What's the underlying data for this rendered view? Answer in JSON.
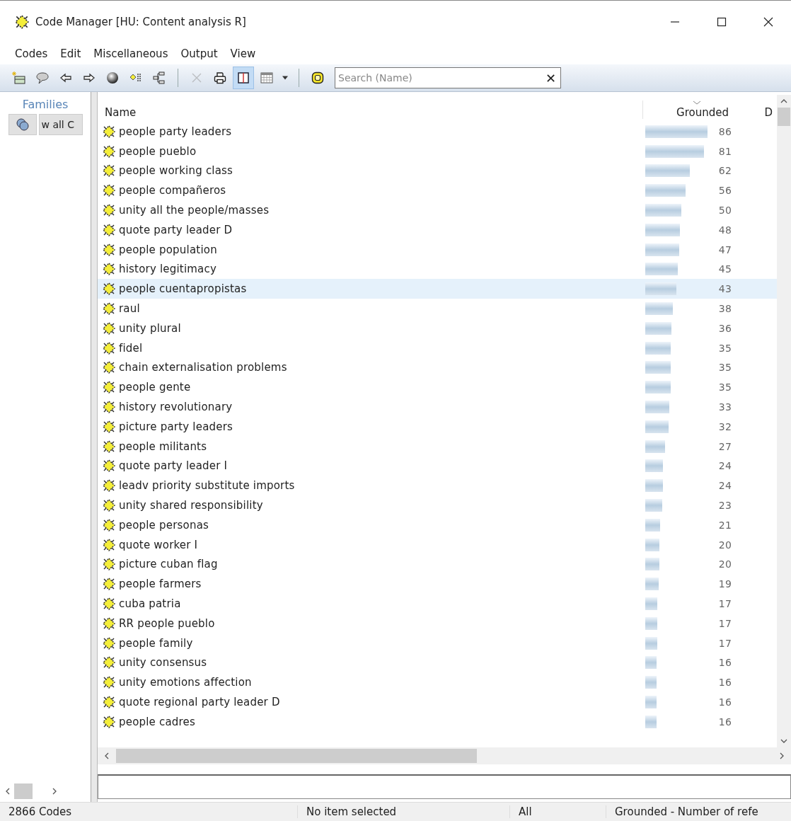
{
  "window": {
    "title": "Code Manager [HU: Content analysis R]"
  },
  "menu": [
    "Codes",
    "Edit",
    "Miscellaneous",
    "Output",
    "View"
  ],
  "toolbar": [
    {
      "kind": "new-code",
      "pressed": false,
      "disabled": false
    },
    {
      "kind": "comment",
      "pressed": false,
      "disabled": false
    },
    {
      "kind": "back",
      "pressed": false,
      "disabled": false
    },
    {
      "kind": "forward",
      "pressed": false,
      "disabled": false
    },
    {
      "kind": "sphere",
      "pressed": false,
      "disabled": false
    },
    {
      "kind": "code-list",
      "pressed": false,
      "disabled": false
    },
    {
      "kind": "tree",
      "pressed": false,
      "disabled": false
    },
    {
      "kind": "sep"
    },
    {
      "kind": "delete",
      "pressed": false,
      "disabled": true
    },
    {
      "kind": "print",
      "pressed": false,
      "disabled": false
    },
    {
      "kind": "split",
      "pressed": true,
      "disabled": false
    },
    {
      "kind": "grid",
      "pressed": false,
      "disabled": false
    },
    {
      "kind": "dropdown",
      "pressed": false,
      "disabled": false
    },
    {
      "kind": "sep"
    },
    {
      "kind": "code-filter",
      "pressed": false,
      "disabled": false
    }
  ],
  "search": {
    "placeholder": "Search (Name)",
    "clear": "✕"
  },
  "sidebar": {
    "title": "Families",
    "button": "w all C"
  },
  "table": {
    "columns": [
      "Name",
      "Grounded",
      "D"
    ],
    "rows": [
      {
        "name": "people party leaders",
        "grounded": "86",
        "hovered": false
      },
      {
        "name": "people pueblo",
        "grounded": "81",
        "hovered": false
      },
      {
        "name": "people working class",
        "grounded": "62",
        "hovered": false
      },
      {
        "name": "people compañeros",
        "grounded": "56",
        "hovered": false
      },
      {
        "name": "unity all the people/masses",
        "grounded": "50",
        "hovered": false
      },
      {
        "name": "quote party leader D",
        "grounded": "48",
        "hovered": false
      },
      {
        "name": "people population",
        "grounded": "47",
        "hovered": false
      },
      {
        "name": "history legitimacy",
        "grounded": "45",
        "hovered": false
      },
      {
        "name": "people cuentapropistas",
        "grounded": "43",
        "hovered": true
      },
      {
        "name": "raul",
        "grounded": "38",
        "hovered": false
      },
      {
        "name": "unity plural",
        "grounded": "36",
        "hovered": false
      },
      {
        "name": "fidel",
        "grounded": "35",
        "hovered": false
      },
      {
        "name": "chain externalisation problems",
        "grounded": "35",
        "hovered": false
      },
      {
        "name": "people gente",
        "grounded": "35",
        "hovered": false
      },
      {
        "name": "history revolutionary",
        "grounded": "33",
        "hovered": false
      },
      {
        "name": "picture party leaders",
        "grounded": "32",
        "hovered": false
      },
      {
        "name": "people militants",
        "grounded": "27",
        "hovered": false
      },
      {
        "name": "quote party leader I",
        "grounded": "24",
        "hovered": false
      },
      {
        "name": "leadv priority substitute imports",
        "grounded": "24",
        "hovered": false
      },
      {
        "name": "unity shared responsibility",
        "grounded": "23",
        "hovered": false
      },
      {
        "name": "people personas",
        "grounded": "21",
        "hovered": false
      },
      {
        "name": "quote worker I",
        "grounded": "20",
        "hovered": false
      },
      {
        "name": "picture cuban flag",
        "grounded": "20",
        "hovered": false
      },
      {
        "name": "people farmers",
        "grounded": "19",
        "hovered": false
      },
      {
        "name": "cuba patria",
        "grounded": "17",
        "hovered": false
      },
      {
        "name": "RR people pueblo",
        "grounded": "17",
        "hovered": false
      },
      {
        "name": "people family",
        "grounded": "17",
        "hovered": false
      },
      {
        "name": "unity consensus",
        "grounded": "16",
        "hovered": false
      },
      {
        "name": "unity emotions affection",
        "grounded": "16",
        "hovered": false
      },
      {
        "name": "quote regional party leader D",
        "grounded": "16",
        "hovered": false
      },
      {
        "name": "people cadres",
        "grounded": "16",
        "hovered": false
      }
    ]
  },
  "status_bar": [
    "2866 Codes",
    "No item selected",
    "All",
    "Grounded - Number of refe"
  ]
}
